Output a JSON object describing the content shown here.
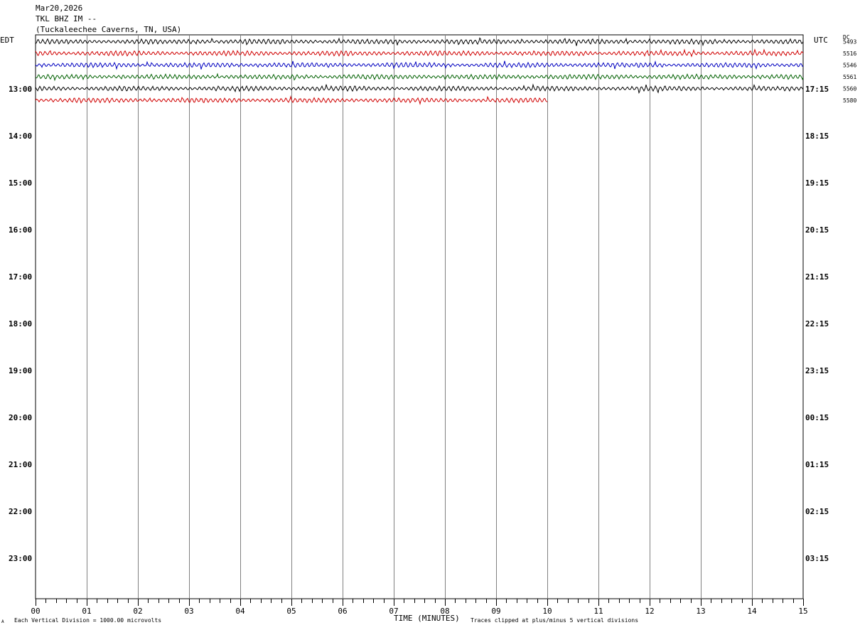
{
  "header": {
    "date": "Mar20,2026",
    "station": "TKL BHZ IM --",
    "location": "(Tuckaleechee Caverns, TN, USA)"
  },
  "left_tz": "EDT",
  "right_tz": "UTC",
  "dc_label": "DC",
  "footer": {
    "scale_note": "Each Vertical Division = 1000.00 microvolts",
    "xlabel": "TIME (MINUTES)",
    "clip_note": "Traces clipped at plus/minus 5 vertical divisions",
    "corner_mark": "A"
  },
  "chart_data": {
    "type": "line",
    "x_ticks": [
      "00",
      "01",
      "02",
      "03",
      "04",
      "05",
      "06",
      "07",
      "08",
      "09",
      "10",
      "11",
      "12",
      "13",
      "14",
      "15"
    ],
    "xlabel": "TIME (MINUTES)",
    "xlim": [
      0,
      15
    ],
    "left_hour_labels": [
      "13:00",
      "14:00",
      "15:00",
      "16:00",
      "17:00",
      "18:00",
      "19:00",
      "20:00",
      "21:00",
      "22:00",
      "23:00"
    ],
    "right_hour_labels": [
      "17:15",
      "18:15",
      "19:15",
      "20:15",
      "21:15",
      "22:15",
      "23:15",
      "00:15",
      "01:15",
      "02:15",
      "03:15"
    ],
    "series": [
      {
        "row": 0,
        "color": "#000000",
        "dc": "5493",
        "end_minute": 15
      },
      {
        "row": 1,
        "color": "#d00000",
        "dc": "5516",
        "end_minute": 15
      },
      {
        "row": 2,
        "color": "#0000c0",
        "dc": "5546",
        "end_minute": 15
      },
      {
        "row": 3,
        "color": "#006000",
        "dc": "5561",
        "end_minute": 15
      },
      {
        "row": 4,
        "color": "#000000",
        "dc": "5560",
        "end_minute": 15
      },
      {
        "row": 5,
        "color": "#d00000",
        "dc": "5580",
        "end_minute": 10
      }
    ]
  }
}
